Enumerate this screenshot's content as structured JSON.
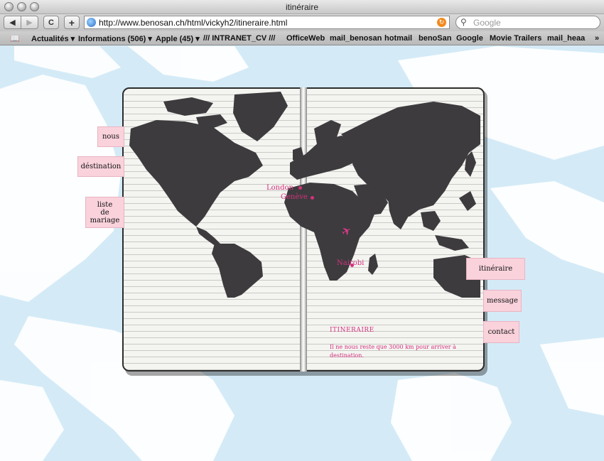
{
  "browser": {
    "window_title": "itinéraire",
    "url": "http://www.benosan.ch/html/vickyh2/itineraire.html",
    "search_placeholder": "Google",
    "back_symbol": "◀",
    "forward_symbol": "▶",
    "reload_symbol": "C",
    "add_symbol": "+",
    "bookmarks_icon": "📖",
    "bookmarks": [
      {
        "label": "Actualités ▾"
      },
      {
        "label": "Informations (506) ▾"
      },
      {
        "label": "Apple (45) ▾"
      },
      {
        "label": "/// INTRANET_CV ///"
      },
      {
        "label": "OfficeWeb"
      },
      {
        "label": "mail_benosan"
      },
      {
        "label": "hotmail"
      },
      {
        "label": "benoSan"
      },
      {
        "label": "Google"
      },
      {
        "label": "Movie Trailers"
      },
      {
        "label": "mail_heaa"
      }
    ],
    "overflow": "»"
  },
  "page": {
    "nav_left": [
      {
        "label": "nous"
      },
      {
        "label": "déstination"
      },
      {
        "label": "liste\nde\nmariage"
      }
    ],
    "nav_right": [
      {
        "label": "itinéraire"
      },
      {
        "label": "message"
      },
      {
        "label": "contact"
      }
    ],
    "cities": [
      {
        "name": "London"
      },
      {
        "name": "Genève"
      },
      {
        "name": "Nairobi"
      }
    ],
    "plane_icon": "✈",
    "itinerary_title": "ITINERAIRE",
    "itinerary_text": "Il ne nous reste que 3000 km pour arriver à destination."
  },
  "colors": {
    "accent_pink": "#d4317d",
    "tab_pink": "#f9d2dc",
    "map_dark": "#3d3b3e",
    "sky_blue": "#d4ebf7"
  }
}
